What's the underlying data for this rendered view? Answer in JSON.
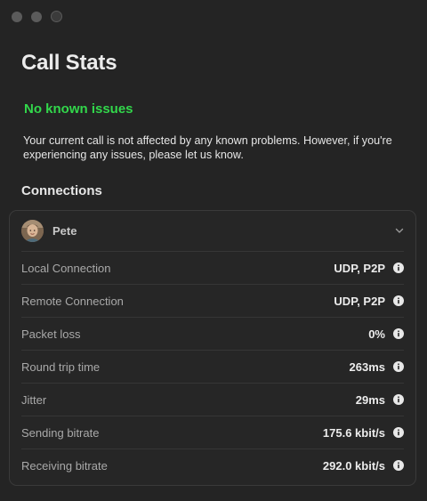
{
  "window": {
    "traffic_lights": [
      "close",
      "minimize",
      "zoom"
    ]
  },
  "title": "Call Stats",
  "status": {
    "text": "No known issues",
    "color": "#32d74b"
  },
  "description": "Your current call is not affected by any known problems. However, if you're experiencing any issues, please let us know.",
  "connections": {
    "heading": "Connections",
    "participant": {
      "name": "Pete",
      "avatar_icon": "user-avatar",
      "expand_icon": "chevron-down-icon"
    },
    "rows": [
      {
        "label": "Local Connection",
        "value": "UDP, P2P",
        "icon": "info-icon"
      },
      {
        "label": "Remote Connection",
        "value": "UDP, P2P",
        "icon": "info-icon"
      },
      {
        "label": "Packet loss",
        "value": "0%",
        "icon": "info-icon"
      },
      {
        "label": "Round trip time",
        "value": "263ms",
        "icon": "info-icon"
      },
      {
        "label": "Jitter",
        "value": "29ms",
        "icon": "info-icon"
      },
      {
        "label": "Sending bitrate",
        "value": "175.6 kbit/s",
        "icon": "info-icon"
      },
      {
        "label": "Receiving bitrate",
        "value": "292.0 kbit/s",
        "icon": "info-icon"
      }
    ]
  }
}
